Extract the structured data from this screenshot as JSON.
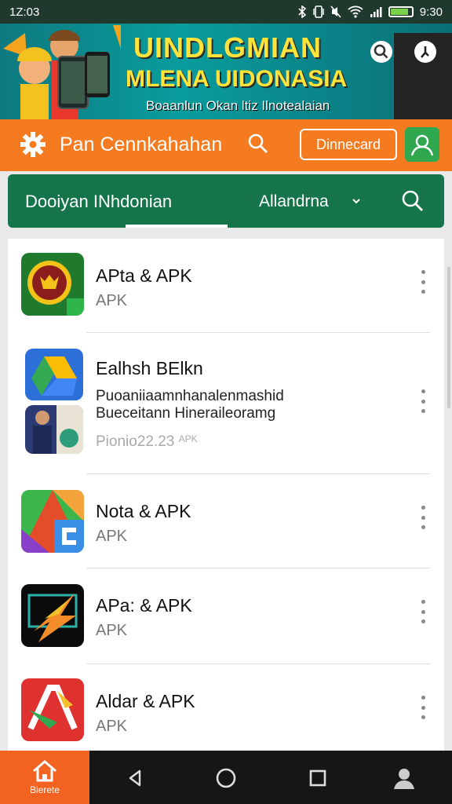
{
  "status_bar": {
    "time_left": "1Z:03",
    "time_right": "9:30",
    "icons": [
      "bluetooth-icon",
      "vibrate-icon",
      "mute-icon",
      "wifi-icon",
      "signal-icon",
      "battery-icon"
    ]
  },
  "banner": {
    "title_line1": "UINDLGMIAN",
    "title_line2": "MLENA UIDONASIA",
    "subtitle": "Boaanlun Okan ltiz Ilnotealaian",
    "icons": [
      "search-icon",
      "info-icon"
    ]
  },
  "toolbar": {
    "title": "Pan Cennkahahan",
    "download_label": "Dinnecard",
    "icons": [
      "gear-icon",
      "search-icon",
      "user-icon"
    ]
  },
  "tabs": {
    "tab1_label": "Dooiyan INhdonian",
    "tab2_label": "Allandrna",
    "icons": [
      "chevron-down-icon",
      "search-icon"
    ]
  },
  "apps": [
    {
      "name": "APta & APK",
      "subtitle": "APK"
    },
    {
      "name": "Ealhsh BElkn",
      "desc_line1": "Puoaniiaamnhanalenmashid",
      "desc_line2": "Bueceitann Hineraileoramg",
      "version": "Pionio22.23",
      "version_tag": "APK"
    },
    {
      "name": "Nota & APK",
      "subtitle": "APK"
    },
    {
      "name": "APa: & APK",
      "subtitle": "APK"
    },
    {
      "name": "Aldar & APK",
      "subtitle": "APK"
    }
  ],
  "bottom_nav": {
    "home_label": "Bierete",
    "icons": [
      "home-icon",
      "back-icon",
      "home-circle-icon",
      "recents-icon",
      "profile-icon"
    ]
  },
  "colors": {
    "status_bar": "#1f3a2d",
    "orange": "#f47b20",
    "green": "#15744a",
    "banner_yellow": "#ffe23a"
  }
}
